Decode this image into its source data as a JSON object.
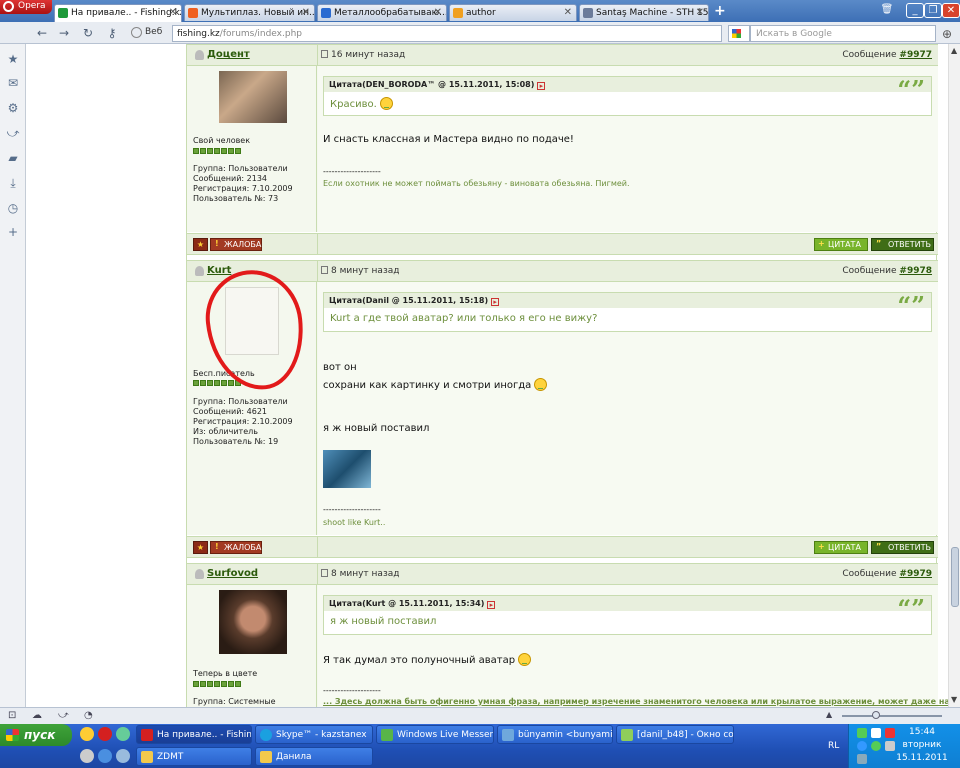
{
  "browser": {
    "opera_label": "Opera",
    "tabs": [
      {
        "label": "На привале.. - Fishing.kz",
        "icon_color": "#1e9a3a"
      },
      {
        "label": "Мультиплаз. Новый ин...",
        "icon_color": "#f06020"
      },
      {
        "label": "Металлообрабатываю...",
        "icon_color": "#2a6bd1"
      },
      {
        "label": "author",
        "icon_color": "#f0a020"
      },
      {
        "label": "Santaş Machine - STH 15...",
        "icon_color": "#6b7b9a"
      }
    ],
    "web_label": "Веб",
    "address_host": "fishing.kz",
    "address_path": "/forums/index.php",
    "search_placeholder": "Искать в Google"
  },
  "posts": [
    {
      "username": "Доцент",
      "time": "16 минут назад",
      "msg_prefix": "Сообщение",
      "msg_number": "#9977",
      "rank": "Свой человек",
      "info": [
        "Группа: Пользователи",
        "Сообщений: 2134",
        "Регистрация: 7.10.2009",
        "Пользователь №: 73"
      ],
      "quote_header": "Цитата(DEN_BORODA™ @ 15.11.2011, 15:08)",
      "quote_text": "Красиво.",
      "body": [
        "И снасть классная и Мастера видно по подаче!"
      ],
      "separator": "--------------------",
      "signature": "Если охотник не может поймать обезьяну - виновата обезьяна. Пигмей."
    },
    {
      "username": "Kurt",
      "time": "8 минут назад",
      "msg_prefix": "Сообщение",
      "msg_number": "#9978",
      "rank": "Бесп.писатель",
      "info": [
        "Группа: Пользователи",
        "Сообщений: 4621",
        "Регистрация: 2.10.2009",
        "Из: обличитель",
        "Пользователь №: 19"
      ],
      "quote_header": "Цитата(Danil @ 15.11.2011, 15:18)",
      "quote_text": "Kurt а где твой аватар? или только я его не вижу?",
      "body": [
        "вот он",
        "сохрани как картинку и смотри иногда",
        "я ж новый поставил"
      ],
      "separator": "--------------------",
      "signature": "shoot like Kurt.."
    },
    {
      "username": "Surfovod",
      "time": "8 минут назад",
      "msg_prefix": "Сообщение",
      "msg_number": "#9979",
      "rank": "Теперь в цвете",
      "info": [
        "Группа: Системные"
      ],
      "quote_header": "Цитата(Kurt @ 15.11.2011, 15:34)",
      "quote_text": "я ж новый поставил",
      "body": [
        "Я так думал это полуночный аватар"
      ],
      "separator": "--------------------",
      "signature": "... Здесь должна быть офигенно умная фраза, например изречение знаменитого человека или крылатое выражение, может даже на"
    }
  ],
  "buttons": {
    "complaint": "ЖАЛОБА",
    "quote": "ЦИТАТА",
    "reply": "ОТВЕТИТЬ"
  },
  "taskbar": {
    "start": "пуск",
    "row1": [
      "На привале.. - Fishin...",
      "Skype™ - kazstanex",
      "Windows Live Messen...",
      "bünyamin <bunyamin...",
      "[danil_b48] - Окно со..."
    ],
    "row2": [
      "ZDMT",
      "Данила"
    ],
    "lang": "RL",
    "time": "15:44",
    "day": "вторник",
    "date": "15.11.2011"
  }
}
